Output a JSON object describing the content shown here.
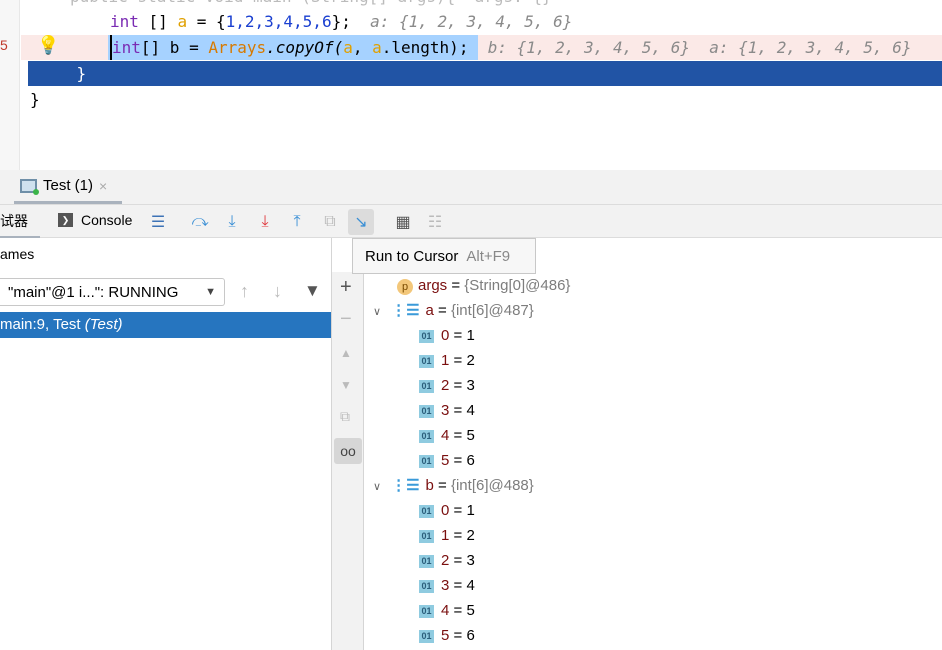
{
  "editor": {
    "line0": "public static void main (String[] args){  args: {}",
    "line1": {
      "kw": "int",
      "rest1": " [] ",
      "var": "a",
      "rest2": " = {",
      "nums": "1,2,3,4,5,6",
      "rest3": "};",
      "hint": "  a: {1, 2, 3, 4, 5, 6}"
    },
    "line2": {
      "kw": "int",
      "rest1": "[] b = ",
      "cls": "Arrays",
      "method": ".copyOf(",
      "v1": "a",
      "sep": ", ",
      "v2": "a",
      "tail": ".length);",
      "hint": "  b: {1, 2, 3, 4, 5, 6}  a: {1, 2, 3, 4, 5, 6}"
    },
    "line3": "    }",
    "line4": "}",
    "gutter_number": "5",
    "colors": {
      "exec_line": "#2154a5",
      "breakpoint_line": "#fbe9e7",
      "selection": "#a6d2ff"
    }
  },
  "tab": {
    "label": "Test (1)",
    "close": "×"
  },
  "toolbar": {
    "debugger_label": "试器",
    "console_label": "Console",
    "tooltip": {
      "label": "Run to Cursor",
      "shortcut": "Alt+F9"
    }
  },
  "frames": {
    "header": "ames",
    "thread": "\"main\"@1 i...\": RUNNING",
    "frame_main": "main:9, Test ",
    "frame_class": "(Test)"
  },
  "variables": [
    {
      "type": "p",
      "name": "args",
      "value": "{String[0]@486}"
    },
    {
      "type": "array",
      "name": "a",
      "value": "{int[6]@487}",
      "items": [
        {
          "i": "0",
          "v": "1"
        },
        {
          "i": "1",
          "v": "2"
        },
        {
          "i": "2",
          "v": "3"
        },
        {
          "i": "3",
          "v": "4"
        },
        {
          "i": "4",
          "v": "5"
        },
        {
          "i": "5",
          "v": "6"
        }
      ]
    },
    {
      "type": "array",
      "name": "b",
      "value": "{int[6]@488}",
      "items": [
        {
          "i": "0",
          "v": "1"
        },
        {
          "i": "1",
          "v": "2"
        },
        {
          "i": "2",
          "v": "3"
        },
        {
          "i": "3",
          "v": "4"
        },
        {
          "i": "4",
          "v": "5"
        },
        {
          "i": "5",
          "v": "6"
        }
      ]
    }
  ]
}
